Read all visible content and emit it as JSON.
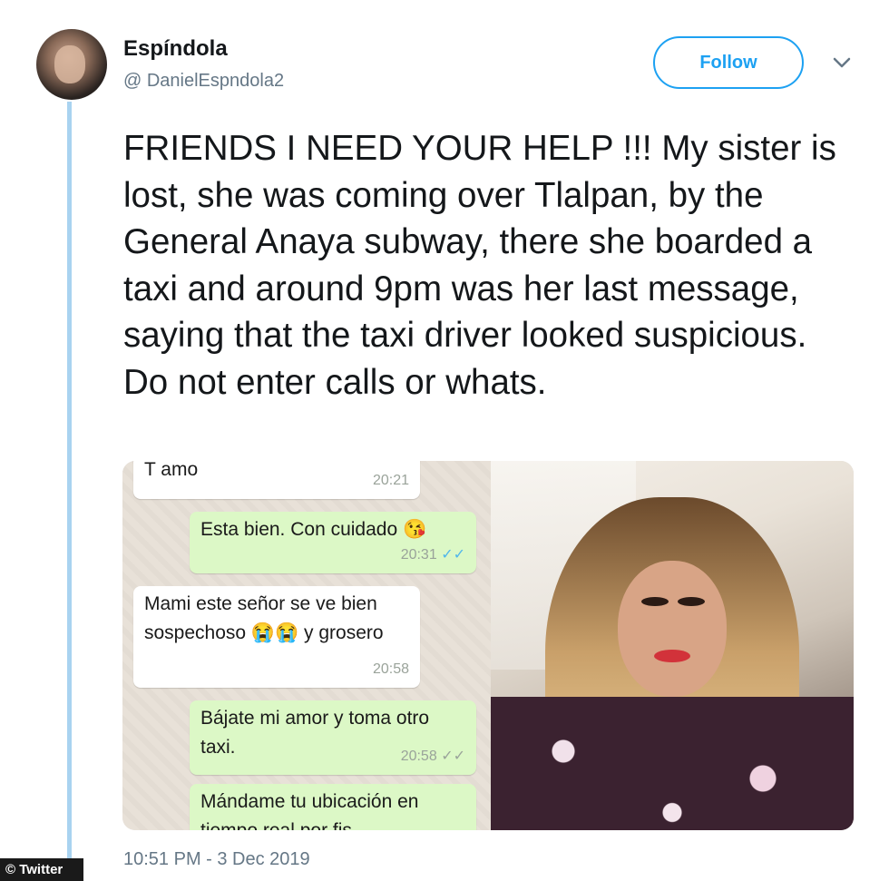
{
  "user": {
    "name": "Espíndola",
    "handle": "@ DanielEspndola2"
  },
  "actions": {
    "follow_label": "Follow",
    "more_icon": "chevron-down-icon"
  },
  "tweet": {
    "text": "FRIENDS I NEED YOUR HELP !!! My sister is lost, she was coming over Tlalpan, by the General Anaya subway, there she boarded a taxi and around 9pm was her last message, saying that the taxi driver looked suspicious. Do not enter calls or whats.",
    "timestamp": "10:51 PM - 3 Dec 2019"
  },
  "chat": {
    "messages": [
      {
        "text": "T amo",
        "time": "20:21",
        "dir": "in"
      },
      {
        "text": "Esta bien. Con cuidado 😘",
        "time": "20:31",
        "dir": "out",
        "ticks": "✓✓"
      },
      {
        "text": "Mami este señor se ve bien sospechoso 😭😭 y grosero",
        "time": "20:58",
        "dir": "in"
      },
      {
        "text": "Bájate mi amor y toma otro taxi.",
        "time": "20:58",
        "dir": "out",
        "ticks": "✓✓"
      },
      {
        "text": "Mándame tu ubicación en tiempo real por fis",
        "time": "",
        "dir": "out"
      }
    ]
  },
  "credit": "© Twitter",
  "colors": {
    "accent": "#1da1f2",
    "thread_line": "#a9d3f0",
    "outgoing_bubble": "#dcf8c6",
    "incoming_bubble": "#ffffff"
  }
}
